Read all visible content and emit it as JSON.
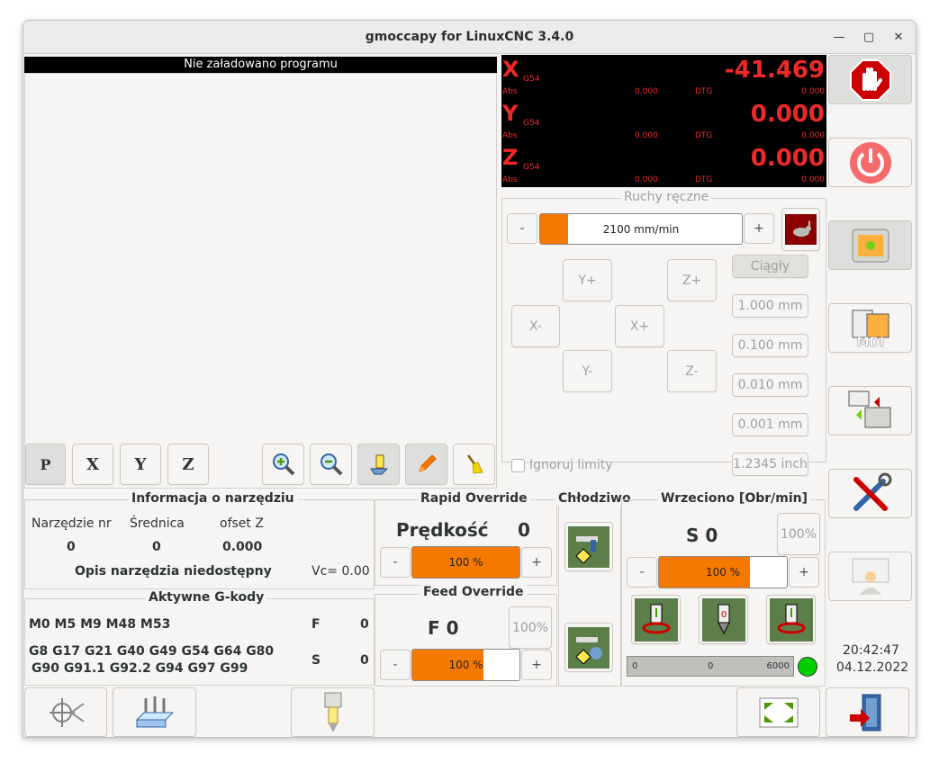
{
  "window": {
    "title": "gmoccapy for LinuxCNC  3.4.0"
  },
  "program": {
    "header": "Nie załadowano programu"
  },
  "preview_buttons": {
    "p": "P",
    "x": "X",
    "y": "Y",
    "z": "Z"
  },
  "dro": {
    "axes": [
      {
        "name": "X",
        "coord": "G54",
        "abs_label": "Abs",
        "abs": "0.000",
        "dtg_label": "DTG",
        "dtg": "0.000",
        "value": "-41.469"
      },
      {
        "name": "Y",
        "coord": "G54",
        "abs_label": "Abs",
        "abs": "0.000",
        "dtg_label": "DTG",
        "dtg": "0.000",
        "value": "0.000"
      },
      {
        "name": "Z",
        "coord": "G54",
        "abs_label": "Abs",
        "abs": "0.000",
        "dtg_label": "DTG",
        "dtg": "0.000",
        "value": "0.000"
      }
    ],
    "color": "#ef2929"
  },
  "jog": {
    "title": "Ruchy ręczne",
    "minus": "-",
    "plus": "+",
    "speed": "2100 mm/min",
    "speed_fraction": 0.13,
    "buttons": {
      "yplus": "Y+",
      "zplus": "Z+",
      "xminus": "X-",
      "xplus": "X+",
      "yminus": "Y-",
      "zminus": "Z-"
    },
    "increments": [
      "Ciągły",
      "1.000 mm",
      "0.100 mm",
      "0.010 mm",
      "0.001 mm",
      "1.2345 inch"
    ],
    "ignore_limits": "Ignoruj limity"
  },
  "tool": {
    "title": "Informacja o narzędziu",
    "headers": [
      "Narzędzie nr",
      "Średnica",
      "ofset Z"
    ],
    "values": [
      "0",
      "0",
      "0.000"
    ],
    "desc": "Opis narzędzia niedostępny",
    "vc": "Vc= 0.00"
  },
  "gcodes": {
    "title": "Aktywne G-kody",
    "mcodes": "M0 M5 M9 M48 M53",
    "f_label": "F",
    "f_value": "0",
    "gcodes_line1": "G8 G17 G21 G40 G49 G54 G64 G80",
    "gcodes_line2": "G90 G91.1 G92.2 G94 G97 G99",
    "s_label": "S",
    "s_value": "0"
  },
  "rapid": {
    "title": "Rapid Override",
    "label": "Prędkość",
    "value": "0",
    "percent": "100 %",
    "fraction": 1.0,
    "minus": "-",
    "plus": "+"
  },
  "feed": {
    "title": "Feed Override",
    "value": "F 0",
    "reset": "100%",
    "percent": "100 %",
    "fraction": 0.5,
    "minus": "-",
    "plus": "+"
  },
  "coolant": {
    "title": "Chłodziwo"
  },
  "spindle": {
    "title": "Wrzeciono [Obr/min]",
    "value": "S 0",
    "reset": "100%",
    "percent": "100 %",
    "fraction": 0.7,
    "minus": "-",
    "plus": "+",
    "bar_min": "0",
    "bar_mid": "0",
    "bar_max": "6000"
  },
  "clock": {
    "time": "20:42:47",
    "date": "04.12.2022"
  },
  "colors": {
    "accent": "#f57900",
    "led": "#00d000"
  }
}
